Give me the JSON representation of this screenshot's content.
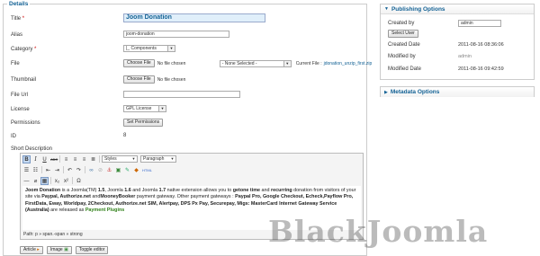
{
  "details": {
    "legend": "Details",
    "title_label": "Title",
    "title_value": "Joom Donation",
    "alias_label": "Alias",
    "alias_value": "joom-donation",
    "category_label": "Category",
    "category_value": "|_ Components",
    "file_label": "File",
    "choose_file": "Choose File",
    "no_file": "No file chosen",
    "none_selected": "- None Selected -",
    "current_file_label": "Current File :",
    "current_file_value": "jdonation_unzip_first.zip",
    "thumbnail_label": "Thumbnail",
    "file_url_label": "File Url",
    "file_url_value": "",
    "license_label": "License",
    "license_value": "GPL License",
    "permissions_label": "Permissions",
    "set_permissions": "Set Permissions",
    "id_label": "ID",
    "id_value": "8",
    "short_desc_label": "Short Description"
  },
  "editor": {
    "styles": "Styles",
    "format": "Paragraph",
    "path": "Path: p » span.-span » strong",
    "c1": "Joom Donation",
    "c2": " is a Joomla(TM) ",
    "c3": "1.5",
    "c4": ", Joomla ",
    "c5": "1.6",
    "c6": " and Joomla ",
    "c7": "1.7",
    "c8": " native extension allows you to ",
    "c9": "get",
    "c10": "one time",
    "c11": " and ",
    "c12": "recurring",
    "c13": " donation from visitors of your site via ",
    "c14": "Paypal, Authorize.net",
    "c15": " and",
    "c16": "MooneyBooker",
    "c17": " payment gateway. Other payment gateways : ",
    "c18": "Paypal Pro, Google Checkout, Echeck,Payflow Pro, FirstData, Eway, Worldpay, 2Checkout, Authorize.net SIM, Alertpay, DPS Px Pay, Securepay, Migs: MasterCard Internet Gateway Service (Australia)",
    "c19": " are released as ",
    "c20": "Payment Plugins"
  },
  "bottom_buttons": {
    "article": "Article",
    "image": "Image",
    "toggle": "Toggle editor"
  },
  "publishing": {
    "title": "Publishing Options",
    "created_by_label": "Created by",
    "created_by_value": "admin",
    "select_user": "Select User",
    "created_date_label": "Created Date",
    "created_date_value": "2011-08-16 08:36:06",
    "modified_by_label": "Modified by",
    "modified_by_value": "admin",
    "modified_date_label": "Modified Date",
    "modified_date_value": "2011-08-16 09:42:59"
  },
  "metadata": {
    "title": "Metadata Options"
  },
  "watermark": "BlackJoomla",
  "colors": {
    "accent": "#146295",
    "title_bg": "#e0effa",
    "plugins_green": "#2f7f18"
  }
}
